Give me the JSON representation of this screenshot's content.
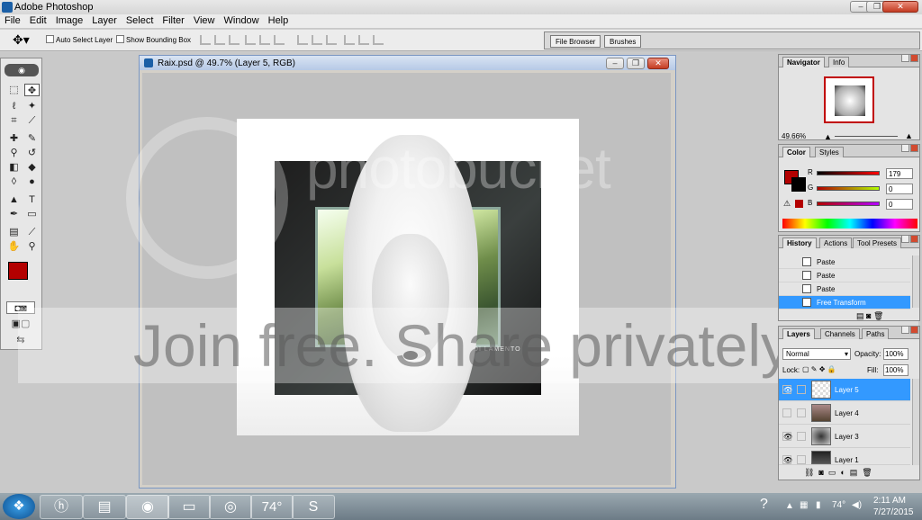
{
  "window": {
    "title": "Adobe Photoshop"
  },
  "menu": [
    "File",
    "Edit",
    "Image",
    "Layer",
    "Select",
    "Filter",
    "View",
    "Window",
    "Help"
  ],
  "options": {
    "auto_select": "Auto Select Layer",
    "show_bounding": "Show Bounding Box"
  },
  "well": {
    "tabs": [
      "File Browser",
      "Brushes"
    ]
  },
  "document": {
    "title": "Raix.psd @ 49.7% (Layer 5, RGB)",
    "signature": "LDI LAMENTO"
  },
  "watermark": {
    "brand": "photobucket",
    "banner": "Join free. Share privately."
  },
  "navigator": {
    "tabs": [
      "Navigator",
      "Info"
    ],
    "zoom": "49.66%"
  },
  "color": {
    "tabs": [
      "Color",
      "Styles"
    ],
    "foreground": "#b30000",
    "channels": [
      {
        "label": "R",
        "value": "179"
      },
      {
        "label": "G",
        "value": "0"
      },
      {
        "label": "B",
        "value": "0"
      }
    ]
  },
  "history": {
    "tabs": [
      "History",
      "Actions",
      "Tool Presets"
    ],
    "items": [
      "Paste",
      "Paste",
      "Paste",
      "Free Transform"
    ]
  },
  "layers": {
    "tabs": [
      "Layers",
      "Channels",
      "Paths"
    ],
    "blend_mode": "Normal",
    "opacity_label": "Opacity:",
    "opacity": "100%",
    "lock_label": "Lock:",
    "fill_label": "Fill:",
    "fill": "100%",
    "items": [
      "Layer 5",
      "Layer 4",
      "Layer 3",
      "Layer 1"
    ]
  },
  "taskbar": {
    "weather": "74°",
    "temp": "74°",
    "time": "2:11 AM",
    "date": "7/27/2015"
  },
  "colors": {
    "accent": "#3399ff",
    "fg_swatch": "#b30000"
  }
}
